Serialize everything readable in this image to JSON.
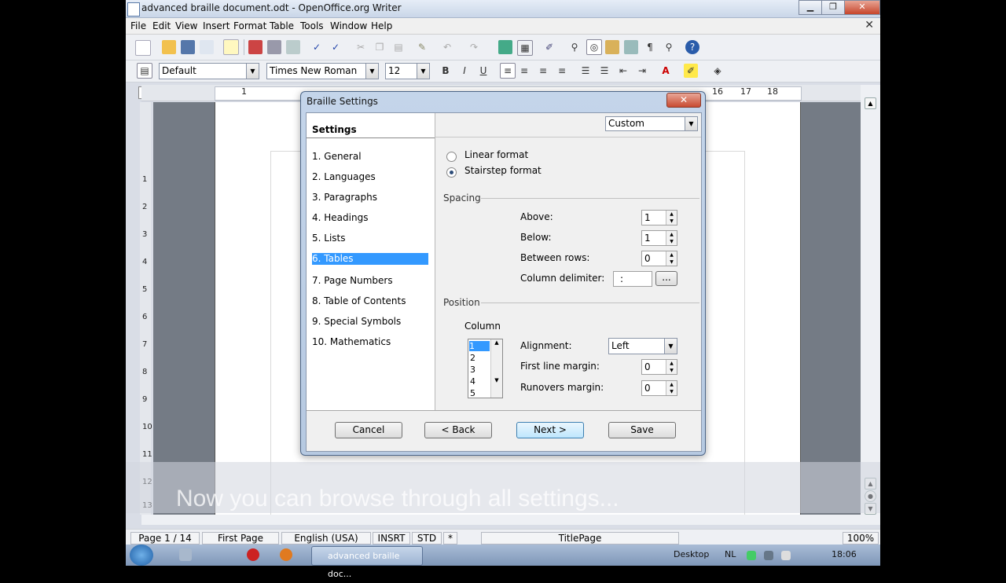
{
  "window": {
    "title": "advanced braille document.odt - OpenOffice.org Writer",
    "min": "▁",
    "max": "❐",
    "close": "✕"
  },
  "menu": [
    "File",
    "Edit",
    "View",
    "Insert",
    "Format",
    "Table",
    "Tools",
    "Window",
    "Help"
  ],
  "doc_close": "✕",
  "formatting": {
    "style": "Default",
    "font": "Times New Roman",
    "size": "12",
    "bold": "B",
    "italic": "I",
    "underline": "U"
  },
  "ruler": {
    "corner": "L",
    "h_nums": [
      "1",
      "16",
      "17",
      "18"
    ],
    "v_nums": [
      "1",
      "2",
      "3",
      "4",
      "5",
      "6",
      "7",
      "8",
      "9",
      "10",
      "11",
      "12",
      "13"
    ]
  },
  "dialog": {
    "title": "Braille Settings",
    "close": "✕",
    "settings_header": "Settings",
    "nav": [
      "1. General",
      "2. Languages",
      "3. Paragraphs",
      "4. Headings",
      "5. Lists",
      "6. Tables",
      "7. Page Numbers",
      "8. Table of Contents",
      "9. Special Symbols",
      "10. Mathematics"
    ],
    "selected_index": 5,
    "preset": "Custom",
    "format_options": [
      "Linear format",
      "Stairstep format"
    ],
    "format_selected": "Stairstep format",
    "spacing": {
      "label": "Spacing",
      "above_label": "Above:",
      "above": "1",
      "below_label": "Below:",
      "below": "1",
      "between_label": "Between rows:",
      "between": "0",
      "delim_label": "Column delimiter:",
      "delim": ":",
      "delim_button": "..."
    },
    "position": {
      "label": "Position",
      "column_label": "Column",
      "columns": [
        "1",
        "2",
        "3",
        "4",
        "5"
      ],
      "alignment_label": "Alignment:",
      "alignment": "Left",
      "first_label": "First line margin:",
      "first": "0",
      "runovers_label": "Runovers margin:",
      "runovers": "0"
    },
    "buttons": {
      "cancel": "Cancel",
      "back": "< Back",
      "next": "Next >",
      "save": "Save"
    }
  },
  "status": {
    "page": "Page 1 / 14",
    "style": "First Page",
    "lang": "English (USA)",
    "insert": "INSRT",
    "std": "STD",
    "mod": "*",
    "pagestyle": "TitlePage",
    "zoom": "100%"
  },
  "caption": "Now you can browse through all settings...",
  "taskbar": {
    "task": "advanced braille doc...",
    "desktop": "Desktop",
    "lang": "NL",
    "time": "18:06"
  }
}
